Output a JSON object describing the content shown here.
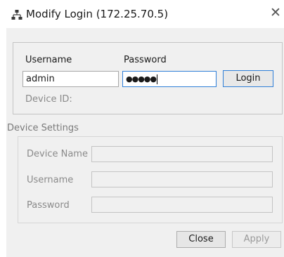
{
  "window": {
    "title": "Modify Login (172.25.70.5)",
    "icon": "network-topology-icon",
    "close_glyph": "✕"
  },
  "login": {
    "username_label": "Username",
    "password_label": "Password",
    "username_value": "admin",
    "password_value": "●●●●●",
    "login_button": "Login",
    "device_id_label": "Device ID:"
  },
  "device_settings": {
    "section_label": "Device Settings",
    "device_name_label": "Device Name",
    "device_name_value": "",
    "username_label": "Username",
    "username_value": "",
    "password_label": "Password",
    "password_value": ""
  },
  "footer": {
    "close_button": "Close",
    "apply_button": "Apply"
  },
  "colors": {
    "focus_border": "#2f7fd8",
    "dialog_background": "#f0f0f0",
    "disabled_text": "#9a9a9a"
  }
}
